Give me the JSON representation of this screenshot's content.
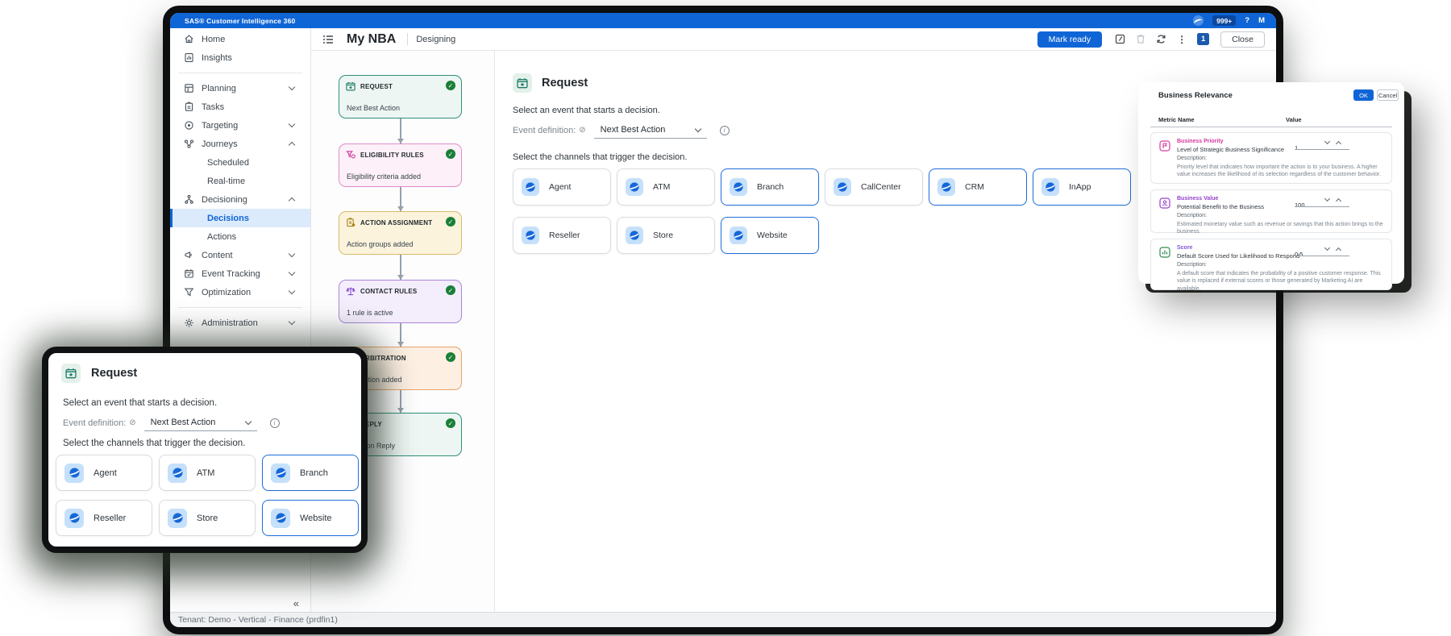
{
  "icons": {
    "check": "✓",
    "collapse": "«",
    "kebab": "⋮",
    "slash": "⊘",
    "info": "i"
  },
  "colors": {
    "accent": "#1065d6",
    "success": "#1a7f37",
    "selected_nav_bg": "#dcebfb",
    "channel_selected_border": "#1f6fd9"
  },
  "topbar": {
    "app_title": "SAS® Customer Intelligence 360",
    "notifications_badge": "999+",
    "help": "?",
    "avatar": "M"
  },
  "header": {
    "title": "My NBA",
    "mode": "Designing",
    "mark_ready": "Mark ready",
    "changes_badge": "1",
    "close": "Close"
  },
  "sidebar": {
    "items": [
      {
        "label": "Home"
      },
      {
        "label": "Insights"
      },
      {
        "label": "Planning",
        "chevron": "down"
      },
      {
        "label": "Tasks"
      },
      {
        "label": "Targeting",
        "chevron": "down"
      },
      {
        "label": "Journeys",
        "chevron": "up"
      },
      {
        "label": "Scheduled",
        "child": true
      },
      {
        "label": "Real-time",
        "child": true
      },
      {
        "label": "Decisioning",
        "chevron": "up"
      },
      {
        "label": "Decisions",
        "child": true,
        "selected": true
      },
      {
        "label": "Actions",
        "child": true
      },
      {
        "label": "Content",
        "chevron": "down"
      },
      {
        "label": "Event Tracking",
        "chevron": "down"
      },
      {
        "label": "Optimization",
        "chevron": "down"
      },
      {
        "label": "Administration",
        "chevron": "down"
      }
    ]
  },
  "flow": {
    "nodes": [
      {
        "title": "REQUEST",
        "subtitle": "Next Best Action",
        "type": "request"
      },
      {
        "title": "ELIGIBILITY RULES",
        "subtitle": "Eligibility criteria added",
        "type": "eligibility"
      },
      {
        "title": "ACTION ASSIGNMENT",
        "subtitle": "Action groups added",
        "type": "action"
      },
      {
        "title": "CONTACT RULES",
        "subtitle": "1 rule is active",
        "type": "contact"
      },
      {
        "title": "ARBITRATION",
        "subtitle": "Arbitration added",
        "type": "arbitration"
      },
      {
        "title": "REPLY",
        "subtitle": "Decision Reply",
        "type": "reply"
      }
    ]
  },
  "request_panel": {
    "title": "Request",
    "event_prompt": "Select an event that starts a decision.",
    "event_label": "Event definition:",
    "event_value": "Next Best Action",
    "channels_prompt": "Select the channels that trigger the decision.",
    "channels": [
      {
        "label": "Agent",
        "selected": false
      },
      {
        "label": "ATM",
        "selected": false
      },
      {
        "label": "Branch",
        "selected": true
      },
      {
        "label": "CallCenter",
        "selected": false
      },
      {
        "label": "CRM",
        "selected": true
      },
      {
        "label": "InApp",
        "selected": true
      },
      {
        "label": "Reseller",
        "selected": false
      },
      {
        "label": "Store",
        "selected": false
      },
      {
        "label": "Website",
        "selected": true
      }
    ]
  },
  "request_popup": {
    "title": "Request",
    "event_prompt": "Select an event that starts a decision.",
    "event_label": "Event definition:",
    "event_value": "Next Best Action",
    "channels_prompt": "Select the channels that trigger the decision.",
    "channels": [
      {
        "label": "Agent",
        "selected": false
      },
      {
        "label": "ATM",
        "selected": false
      },
      {
        "label": "Branch",
        "selected": true
      },
      {
        "label": "Reseller",
        "selected": false
      },
      {
        "label": "Store",
        "selected": false
      },
      {
        "label": "Website",
        "selected": true
      }
    ]
  },
  "business_relevance": {
    "title": "Business Relevance",
    "ok": "OK",
    "cancel": "Cancel",
    "col_metric": "Metric Name",
    "col_value": "Value",
    "description_label": "Description:",
    "metrics": [
      {
        "name": "Business Priority",
        "summary": "Level of Strategic Business Significance",
        "value": "1",
        "color": "#d6399f",
        "description": "Priority level that indicates how important the action is to your business. A higher value increases the likelihood of its selection regardless of the customer behavior."
      },
      {
        "name": "Business Value",
        "summary": "Potential Benefit to the Business",
        "value": "100",
        "color": "#9440cc",
        "description": "Estimated monetary value such as revenue or savings that this action brings to the business."
      },
      {
        "name": "Score",
        "summary": "Default Score Used for Likelihood to Respond",
        "value": "0.5",
        "color": "#7e57d9",
        "description": "A default score that indicates the probability of a positive customer response. This value is replaced if external scores or those generated by Marketing AI are available."
      }
    ]
  },
  "statusbar": {
    "tenant": "Tenant: Demo - Vertical - Finance (prdfin1)"
  }
}
